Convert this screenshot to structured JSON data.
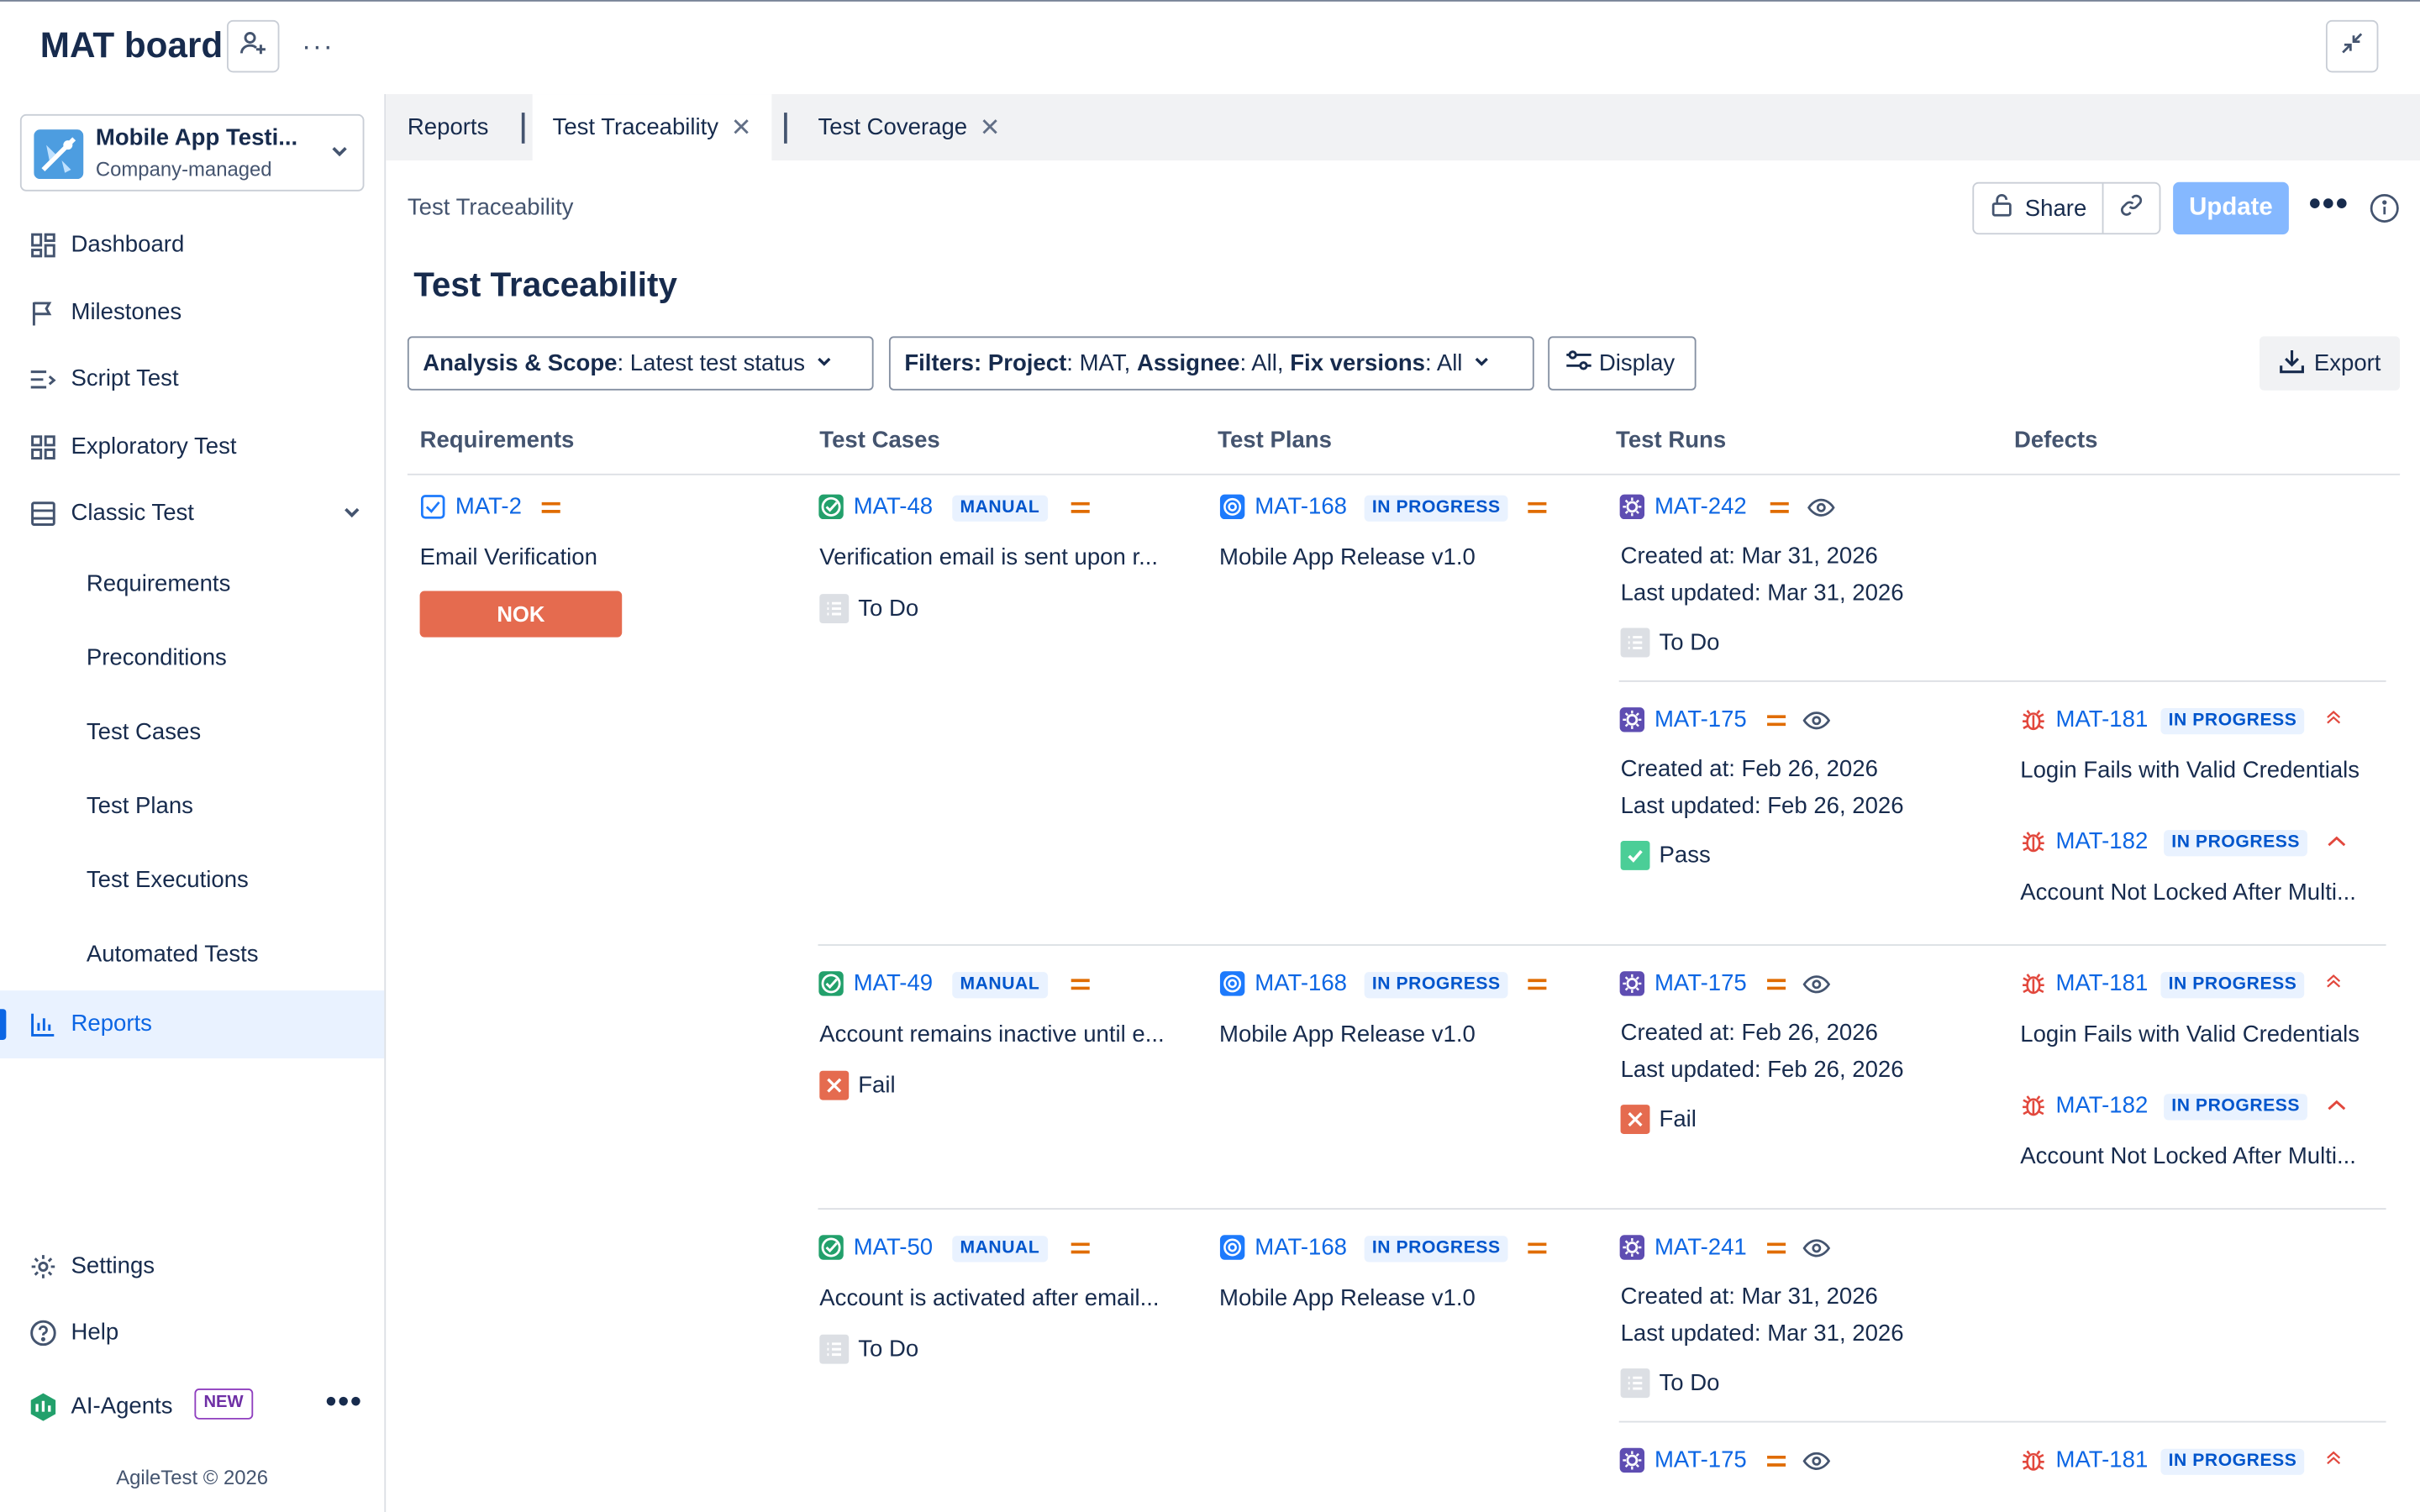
{
  "app": {
    "title": "MAT board"
  },
  "project": {
    "name": "Mobile App Testi...",
    "type": "Company-managed"
  },
  "sidebar": {
    "items": [
      {
        "label": "Dashboard",
        "icon": "dashboard-icon"
      },
      {
        "label": "Milestones",
        "icon": "flag-icon"
      },
      {
        "label": "Script Test",
        "icon": "script-icon"
      },
      {
        "label": "Exploratory Test",
        "icon": "grid-icon"
      },
      {
        "label": "Classic Test",
        "icon": "list-icon"
      },
      {
        "label": "Requirements"
      },
      {
        "label": "Preconditions"
      },
      {
        "label": "Test Cases"
      },
      {
        "label": "Test Plans"
      },
      {
        "label": "Test Executions"
      },
      {
        "label": "Automated Tests"
      },
      {
        "label": "Reports",
        "icon": "chart-icon"
      }
    ],
    "settings": "Settings",
    "help": "Help",
    "ai_agents": "AI-Agents",
    "ai_badge": "NEW",
    "copyright": "AgileTest © 2026"
  },
  "tabs": [
    {
      "label": "Reports"
    },
    {
      "label": "Test Traceability"
    },
    {
      "label": "Test Coverage"
    }
  ],
  "page": {
    "breadcrumb": "Test Traceability",
    "title": "Test Traceability",
    "share": "Share",
    "update": "Update",
    "export": "Export",
    "display": "Display"
  },
  "filters": {
    "analysis_label": "Analysis & Scope",
    "analysis_value": ": Latest test status",
    "filters_label": "Filters:",
    "project_label": "Project",
    "project_value": ": MAT,",
    "assignee_label": "Assignee",
    "assignee_value": ": All,",
    "fix_label": "Fix versions",
    "fix_value": ": All"
  },
  "columns": [
    "Requirements",
    "Test Cases",
    "Test Plans",
    "Test Runs",
    "Defects"
  ],
  "requirement": {
    "key": "MAT-2",
    "title": "Email Verification",
    "result": "NOK"
  },
  "test_cases": [
    {
      "key": "MAT-48",
      "type": "MANUAL",
      "title": "Verification email is sent upon r...",
      "status": "To Do"
    },
    {
      "key": "MAT-49",
      "type": "MANUAL",
      "title": "Account remains inactive until e...",
      "status": "Fail"
    },
    {
      "key": "MAT-50",
      "type": "MANUAL",
      "title": "Account is activated after email...",
      "status": "To Do"
    }
  ],
  "test_plans": [
    {
      "key": "MAT-168",
      "status": "IN PROGRESS",
      "title": "Mobile App Release v1.0"
    },
    {
      "key": "MAT-168",
      "status": "IN PROGRESS",
      "title": "Mobile App Release v1.0"
    },
    {
      "key": "MAT-168",
      "status": "IN PROGRESS",
      "title": "Mobile App Release v1.0"
    }
  ],
  "test_runs": [
    {
      "key": "MAT-242",
      "created": "Created at: Mar 31, 2026",
      "updated": "Last updated: Mar 31, 2026",
      "status": "To Do"
    },
    {
      "key": "MAT-175",
      "created": "Created at: Feb 26, 2026",
      "updated": "Last updated: Feb 26, 2026",
      "status": "Pass"
    },
    {
      "key": "MAT-175",
      "created": "Created at: Feb 26, 2026",
      "updated": "Last updated: Feb 26, 2026",
      "status": "Fail"
    },
    {
      "key": "MAT-241",
      "created": "Created at: Mar 31, 2026",
      "updated": "Last updated: Mar 31, 2026",
      "status": "To Do"
    },
    {
      "key": "MAT-175"
    }
  ],
  "defects": [
    {
      "key": "MAT-181",
      "status": "IN PROGRESS",
      "title": "Login Fails with Valid Credentials"
    },
    {
      "key": "MAT-182",
      "status": "IN PROGRESS",
      "title": "Account Not Locked After Multi..."
    },
    {
      "key": "MAT-181",
      "status": "IN PROGRESS",
      "title": "Login Fails with Valid Credentials"
    },
    {
      "key": "MAT-182",
      "status": "IN PROGRESS",
      "title": "Account Not Locked After Multi..."
    },
    {
      "key": "MAT-181",
      "status": "IN PROGRESS"
    }
  ],
  "colors": {
    "link": "#0c66e4",
    "nok": "#e56b4f",
    "pass": "#4bce97",
    "fail": "#e2483d",
    "priority_medium": "#e06c00",
    "priority_high": "#e2483d",
    "update_button": "#85b8ff",
    "active_nav_bg": "#e9f2ff"
  }
}
